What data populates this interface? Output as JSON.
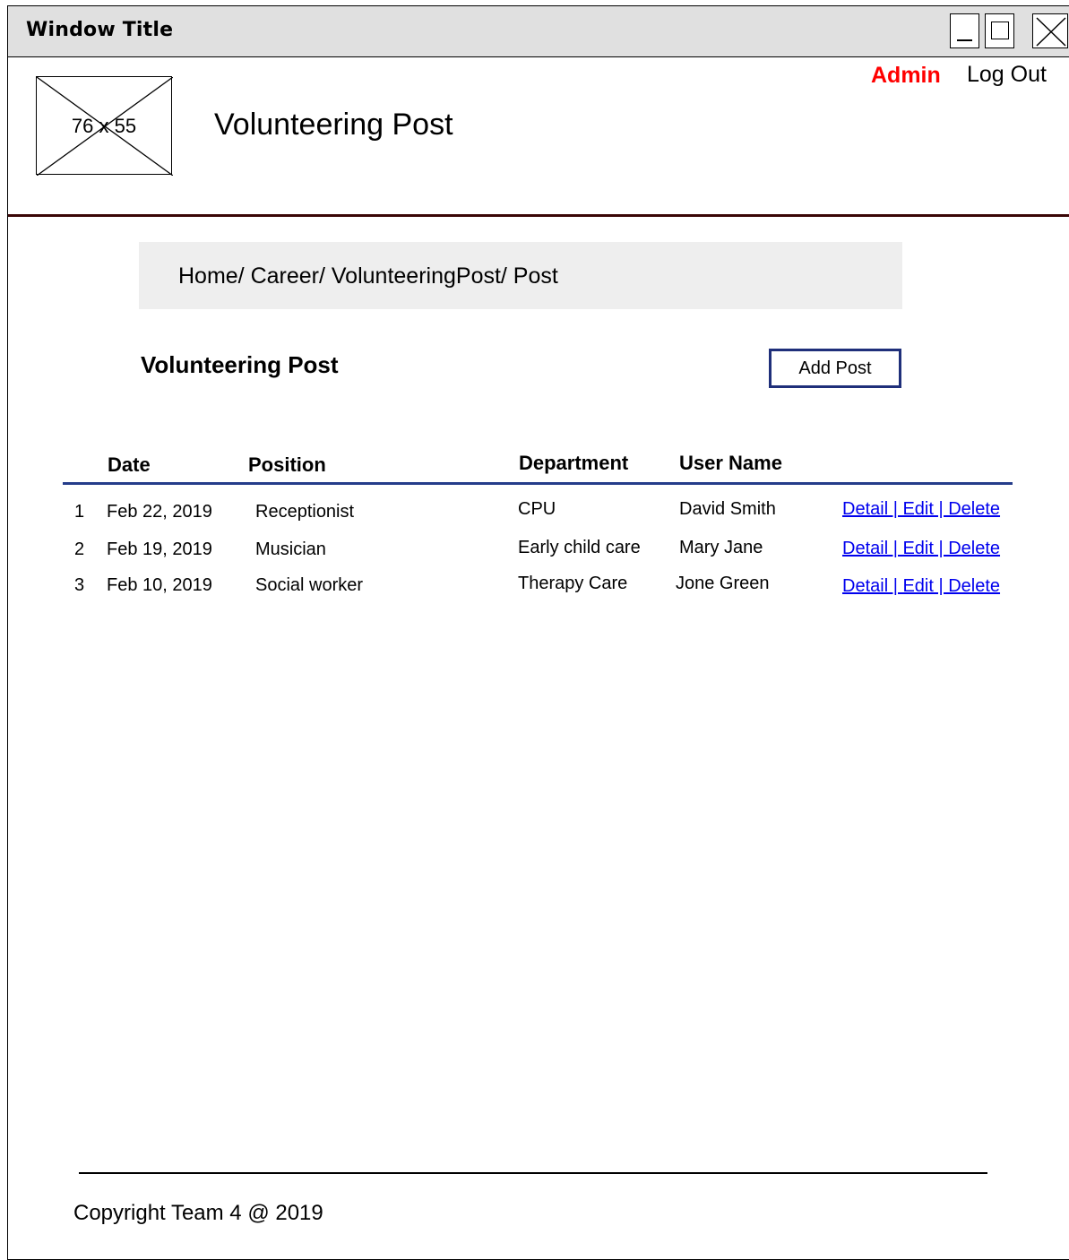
{
  "window": {
    "title": "Window Title"
  },
  "header": {
    "logo_placeholder": "76 x 55",
    "site_title": "Volunteering Post",
    "user": {
      "name": "Admin",
      "color": "#ff0000"
    },
    "logout_label": "Log Out",
    "divider_color": "#3a0606"
  },
  "breadcrumb": "Home/ Career/ VolunteeringPost/ Post",
  "main": {
    "heading": "Volunteering Post",
    "add_button_label": "Add Post",
    "accent_color": "#1f2f7a"
  },
  "table": {
    "columns": [
      "Date",
      "Position",
      "Department",
      "User Name"
    ],
    "rows": [
      {
        "index": "1",
        "date": "Feb 22, 2019",
        "position": "Receptionist",
        "department": "CPU",
        "user": "David Smith",
        "actions": "Detail | Edit | Delete"
      },
      {
        "index": "2",
        "date": "Feb 19, 2019",
        "position": "Musician",
        "department": "Early child care",
        "user": "Mary Jane",
        "actions": "Detail | Edit | Delete"
      },
      {
        "index": "3",
        "date": "Feb 10, 2019",
        "position": "Social worker",
        "department": "Therapy Care",
        "user": "Jone Green",
        "actions": "Detail | Edit | Delete"
      }
    ]
  },
  "footer": {
    "text": "Copyright Team 4 @ 2019"
  }
}
